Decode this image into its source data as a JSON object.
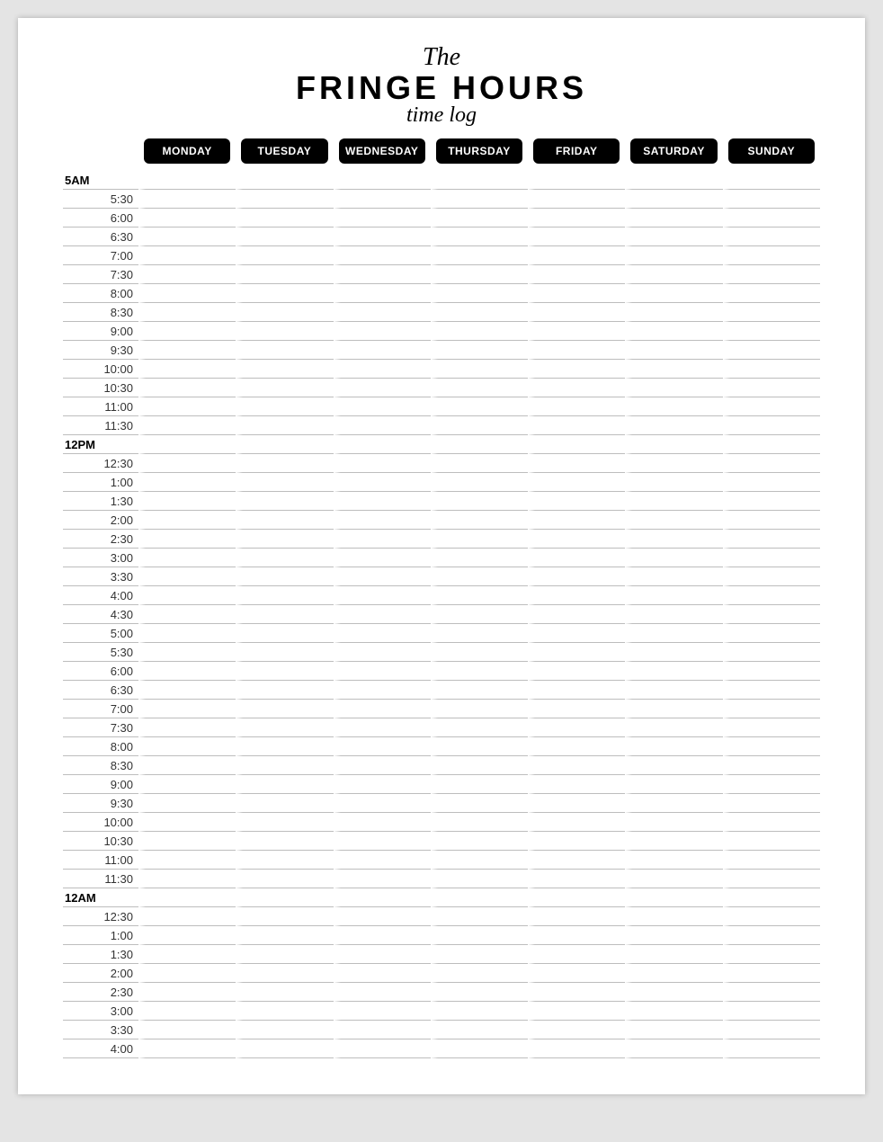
{
  "header": {
    "pretitle": "The",
    "title": "FRINGE HOURS",
    "subtitle": "time log"
  },
  "days": [
    "MONDAY",
    "TUESDAY",
    "WEDNESDAY",
    "THURSDAY",
    "FRIDAY",
    "SATURDAY",
    "SUNDAY"
  ],
  "rows": [
    {
      "label": "5AM",
      "bold": true
    },
    {
      "label": "5:30",
      "bold": false
    },
    {
      "label": "6:00",
      "bold": false
    },
    {
      "label": "6:30",
      "bold": false
    },
    {
      "label": "7:00",
      "bold": false
    },
    {
      "label": "7:30",
      "bold": false
    },
    {
      "label": "8:00",
      "bold": false
    },
    {
      "label": "8:30",
      "bold": false
    },
    {
      "label": "9:00",
      "bold": false
    },
    {
      "label": "9:30",
      "bold": false
    },
    {
      "label": "10:00",
      "bold": false
    },
    {
      "label": "10:30",
      "bold": false
    },
    {
      "label": "11:00",
      "bold": false
    },
    {
      "label": "11:30",
      "bold": false
    },
    {
      "label": "12PM",
      "bold": true
    },
    {
      "label": "12:30",
      "bold": false
    },
    {
      "label": "1:00",
      "bold": false
    },
    {
      "label": "1:30",
      "bold": false
    },
    {
      "label": "2:00",
      "bold": false
    },
    {
      "label": "2:30",
      "bold": false
    },
    {
      "label": "3:00",
      "bold": false
    },
    {
      "label": "3:30",
      "bold": false
    },
    {
      "label": "4:00",
      "bold": false
    },
    {
      "label": "4:30",
      "bold": false
    },
    {
      "label": "5:00",
      "bold": false
    },
    {
      "label": "5:30",
      "bold": false
    },
    {
      "label": "6:00",
      "bold": false
    },
    {
      "label": "6:30",
      "bold": false
    },
    {
      "label": "7:00",
      "bold": false
    },
    {
      "label": "7:30",
      "bold": false
    },
    {
      "label": "8:00",
      "bold": false
    },
    {
      "label": "8:30",
      "bold": false
    },
    {
      "label": "9:00",
      "bold": false
    },
    {
      "label": "9:30",
      "bold": false
    },
    {
      "label": "10:00",
      "bold": false
    },
    {
      "label": "10:30",
      "bold": false
    },
    {
      "label": "11:00",
      "bold": false
    },
    {
      "label": "11:30",
      "bold": false
    },
    {
      "label": "12AM",
      "bold": true
    },
    {
      "label": "12:30",
      "bold": false
    },
    {
      "label": "1:00",
      "bold": false
    },
    {
      "label": "1:30",
      "bold": false
    },
    {
      "label": "2:00",
      "bold": false
    },
    {
      "label": "2:30",
      "bold": false
    },
    {
      "label": "3:00",
      "bold": false
    },
    {
      "label": "3:30",
      "bold": false
    },
    {
      "label": "4:00",
      "bold": false
    }
  ]
}
